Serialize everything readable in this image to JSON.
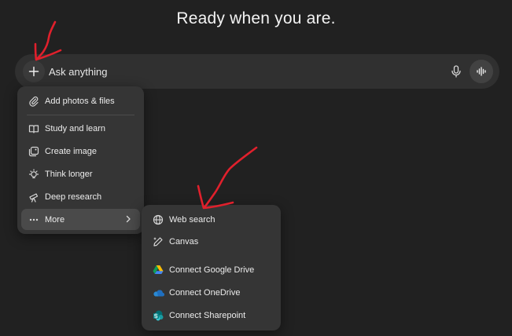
{
  "headline": "Ready when you are.",
  "composer": {
    "placeholder": "Ask anything",
    "icons": {
      "add": "plus-icon",
      "mic": "microphone-icon",
      "voice": "voice-mode-icon"
    }
  },
  "menu": {
    "items": [
      {
        "label": "Add photos & files",
        "icon": "paperclip-icon"
      },
      {
        "label": "Study and learn",
        "icon": "book-icon"
      },
      {
        "label": "Create image",
        "icon": "image-icon"
      },
      {
        "label": "Think longer",
        "icon": "lightbulb-icon"
      },
      {
        "label": "Deep research",
        "icon": "telescope-icon"
      },
      {
        "label": "More",
        "icon": "more-icon"
      }
    ]
  },
  "submenu": {
    "items": [
      {
        "label": "Web search",
        "icon": "globe-icon"
      },
      {
        "label": "Canvas",
        "icon": "pen-icon"
      },
      {
        "label": "Connect Google Drive",
        "icon": "google-drive-icon"
      },
      {
        "label": "Connect OneDrive",
        "icon": "onedrive-icon"
      },
      {
        "label": "Connect Sharepoint",
        "icon": "sharepoint-icon"
      }
    ]
  },
  "colors": {
    "background": "#212121",
    "composer": "#303030",
    "menu": "#353535",
    "annotation": "#e0202c"
  }
}
